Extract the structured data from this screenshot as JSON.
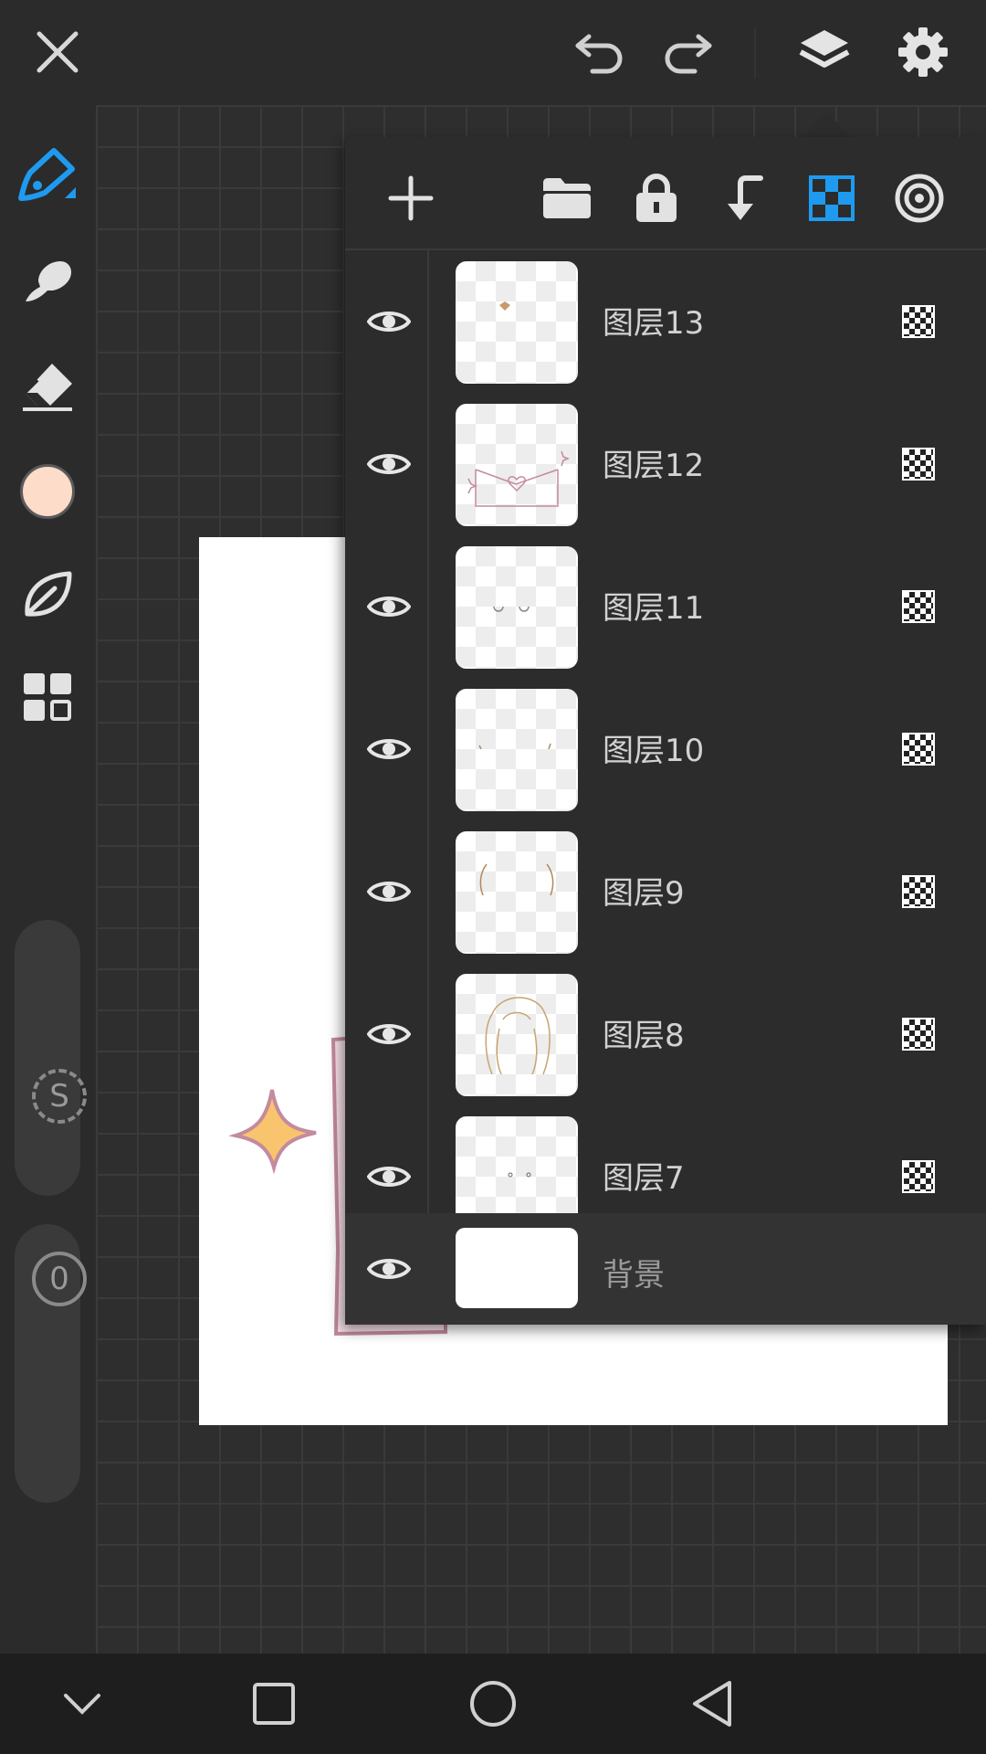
{
  "topbar": {
    "close_icon": "close-icon",
    "undo_icon": "undo-icon",
    "redo_icon": "redo-icon",
    "layers_icon": "layers-icon",
    "settings_icon": "gear-icon"
  },
  "tools": {
    "items": [
      "pen-icon",
      "smudge-icon",
      "eraser-icon",
      "color-swatch",
      "leaf-icon",
      "grid-menu-icon"
    ],
    "current_color": "#FDDCC9",
    "accent_color": "#1E9BF0"
  },
  "sliders": {
    "size_label": "S",
    "opacity_label": "0"
  },
  "layers_panel": {
    "toolbar": [
      "add-icon",
      "folder-icon",
      "lock-icon",
      "merge-down-icon",
      "transparency-icon",
      "clip-icon"
    ],
    "layers": [
      {
        "name": "图层13"
      },
      {
        "name": "图层12"
      },
      {
        "name": "图层11"
      },
      {
        "name": "图层10"
      },
      {
        "name": "图层9"
      },
      {
        "name": "图层8"
      },
      {
        "name": "图层7"
      }
    ],
    "background": {
      "name": "背景"
    }
  },
  "navbar": {
    "items": [
      "chevron-down-icon",
      "recent-apps-icon",
      "home-icon",
      "back-icon"
    ]
  }
}
